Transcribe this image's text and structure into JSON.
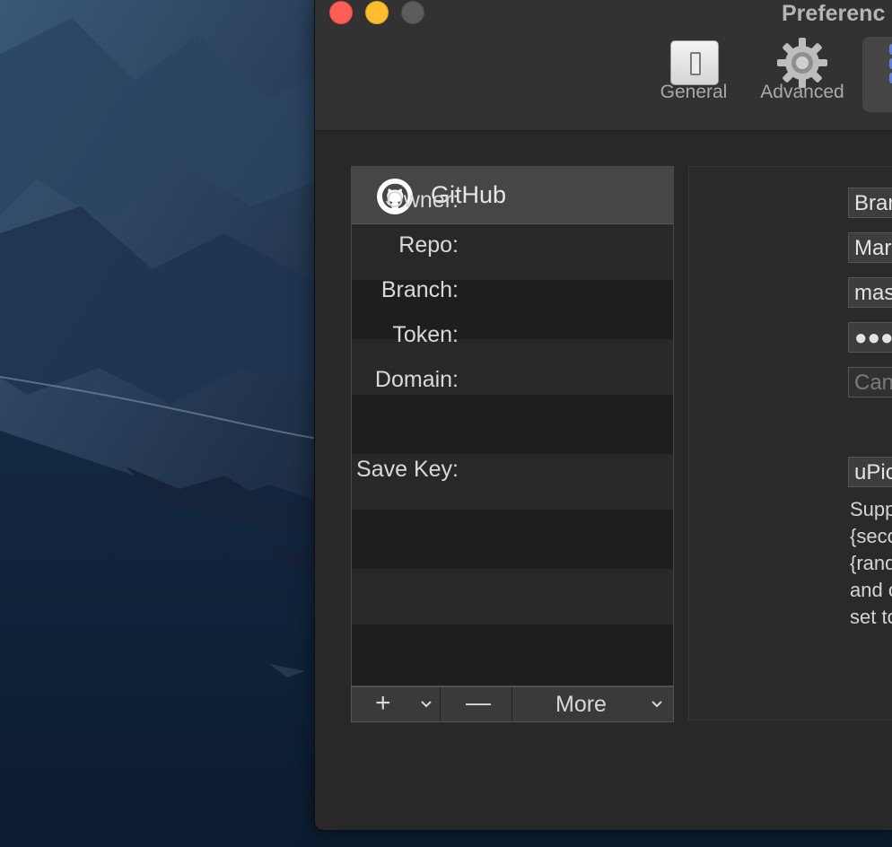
{
  "window": {
    "title": "Preferenc"
  },
  "toolbar": {
    "items": [
      {
        "label": "General",
        "icon": "switch-icon"
      },
      {
        "label": "Advanced",
        "icon": "gear-icon"
      },
      {
        "label": "",
        "icon": "grid-icon"
      }
    ]
  },
  "uploader_list": {
    "items": [
      {
        "label": "GitHub",
        "icon": "github-icon",
        "selected": true
      }
    ],
    "controls": {
      "add": "+",
      "remove": "—",
      "more": "More"
    }
  },
  "form": {
    "owner_label": "Owner:",
    "owner_value": "Brar",
    "repo_label": "Repo:",
    "repo_value": "Mar",
    "branch_label": "Branch:",
    "branch_value": "mas",
    "token_label": "Token:",
    "token_value": "●●●",
    "domain_label": "Domain:",
    "domain_placeholder": "Can",
    "save_key_label": "Save Key:",
    "save_key_value": "uPic",
    "help_lines": [
      "Supp",
      "{seco",
      "{rand",
      "and c",
      "set to"
    ]
  }
}
